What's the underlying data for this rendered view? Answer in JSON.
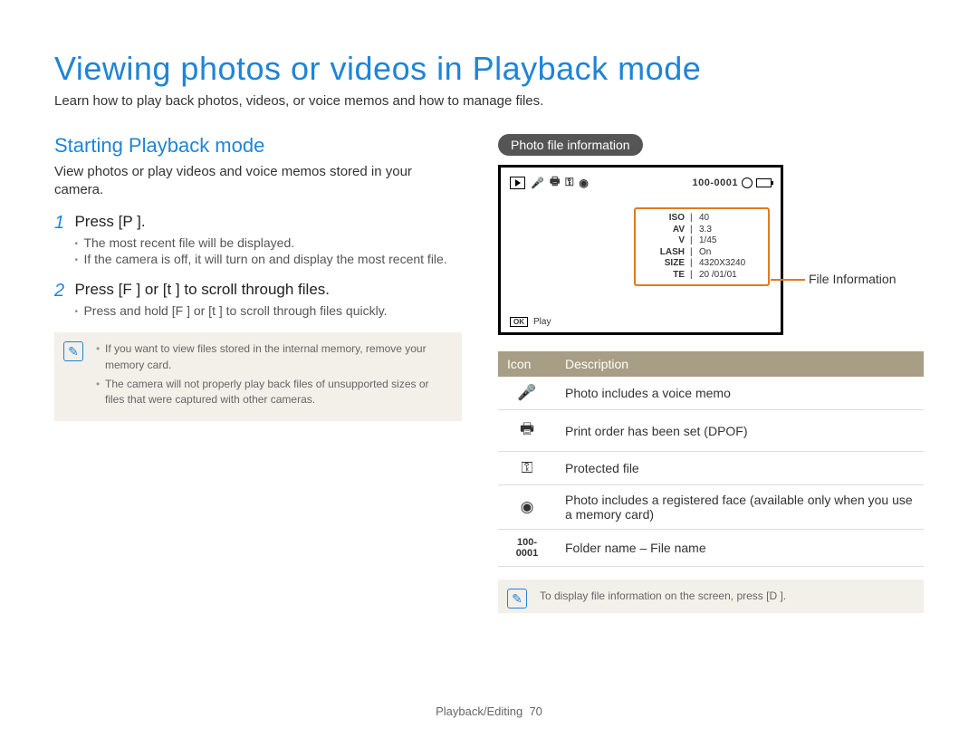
{
  "title": "Viewing photos or videos in Playback mode",
  "lead": "Learn how to play back photos, videos, or voice memos and how to manage files.",
  "left": {
    "subtitle": "Starting Playback mode",
    "sublead": "View photos or play videos and voice memos stored in your camera.",
    "steps": [
      {
        "num": "1",
        "title": "Press [P    ].",
        "subs": [
          "The most recent file will be displayed.",
          "If the camera is off, it will turn on and display the most recent file."
        ]
      },
      {
        "num": "2",
        "title": "Press [F  ] or [t     ] to scroll through files.",
        "subs": [
          "Press and hold [F  ] or [t     ] to scroll through files quickly."
        ]
      }
    ],
    "notes": [
      "If you want to view files stored in the internal memory, remove your memory card.",
      "The camera will not properly play back files of unsupported sizes or files that were captured with other cameras."
    ]
  },
  "right": {
    "pill": "Photo file information",
    "top_file_label": "100-0001",
    "file_info_label": "File Information",
    "info_rows": [
      {
        "k": "ISO",
        "v": "40"
      },
      {
        "k": "AV",
        "v": "3.3"
      },
      {
        "k": "V",
        "v": "1/45"
      },
      {
        "k": "LASH",
        "v": "On"
      },
      {
        "k": "SIZE",
        "v": "4320X3240"
      },
      {
        "k": "TE",
        "v": "20  /01/01"
      }
    ],
    "ok_label": "OK",
    "play_label": "Play",
    "table": {
      "head": {
        "c1": "Icon",
        "c2": "Description"
      },
      "rows": [
        {
          "icon": "🎤",
          "desc": "Photo includes a voice memo",
          "name": "voice-memo-icon"
        },
        {
          "icon": "🖶",
          "desc": "Print order has been set (DPOF)",
          "name": "print-icon"
        },
        {
          "icon": "⚿",
          "desc": "Protected file",
          "name": "lock-icon"
        },
        {
          "icon": "◉",
          "desc": "Photo includes a registered face (available only when you use a memory card)",
          "name": "face-icon"
        },
        {
          "icon": "100-0001",
          "desc": "Folder name – File name",
          "name": "filename-label"
        }
      ]
    },
    "note2": "To display file information on the screen, press [D        ]."
  },
  "footer": {
    "section": "Playback/Editing",
    "page": "70"
  }
}
